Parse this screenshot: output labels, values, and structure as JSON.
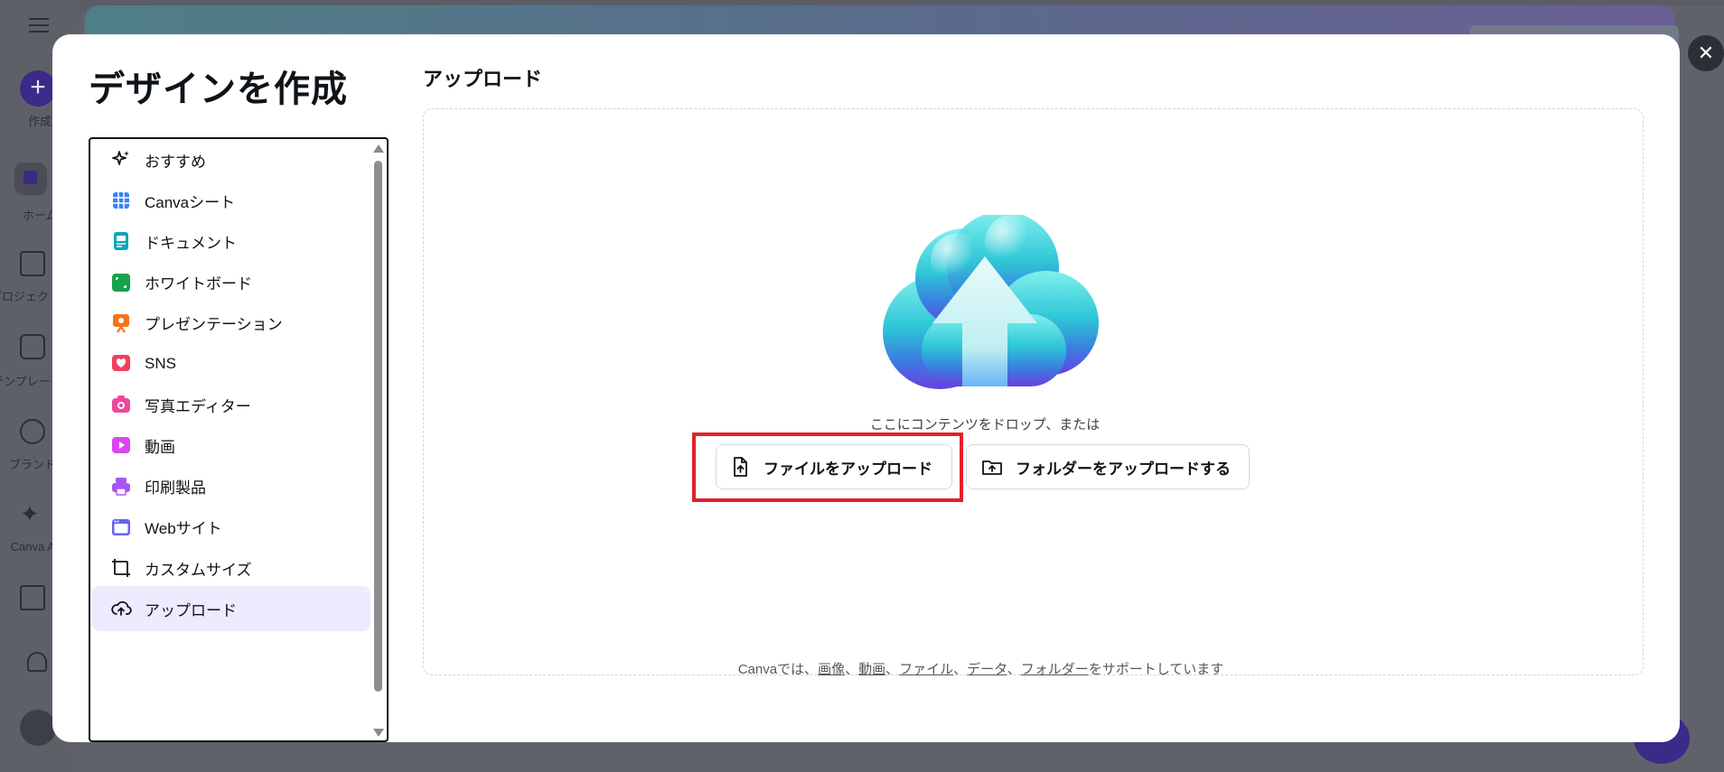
{
  "background": {
    "rail": {
      "create_label": "作成",
      "items": [
        {
          "label": "ホーム"
        },
        {
          "label": "プロジェクト"
        },
        {
          "label": "テンプレート"
        },
        {
          "label": "ブランド"
        },
        {
          "label": "Canva AI"
        }
      ]
    }
  },
  "modal": {
    "title": "デザインを作成",
    "close_symbol": "✕",
    "categories": [
      {
        "label": "おすすめ",
        "icon": "sparkle-icon",
        "color": "#0e1318"
      },
      {
        "label": "Canvaシート",
        "icon": "sheets-icon",
        "color": "#3b82f6"
      },
      {
        "label": "ドキュメント",
        "icon": "document-icon",
        "color": "#0ea5b7"
      },
      {
        "label": "ホワイトボード",
        "icon": "whiteboard-icon",
        "color": "#16a34a"
      },
      {
        "label": "プレゼンテーション",
        "icon": "presentation-icon",
        "color": "#f97316"
      },
      {
        "label": "SNS",
        "icon": "heart-icon",
        "color": "#f43f5e"
      },
      {
        "label": "写真エディター",
        "icon": "camera-icon",
        "color": "#ec4899"
      },
      {
        "label": "動画",
        "icon": "video-icon",
        "color": "#d946ef"
      },
      {
        "label": "印刷製品",
        "icon": "printer-icon",
        "color": "#a855f7"
      },
      {
        "label": "Webサイト",
        "icon": "website-icon",
        "color": "#6366f1"
      },
      {
        "label": "カスタムサイズ",
        "icon": "custom-size-icon",
        "color": "#0e1318"
      },
      {
        "label": "アップロード",
        "icon": "cloud-upload-icon",
        "color": "#0e1318",
        "active": true
      }
    ],
    "upload": {
      "section_title": "アップロード",
      "drop_text": "ここにコンテンツをドロップ、または",
      "file_button": "ファイルをアップロード",
      "folder_button": "フォルダーをアップロードする",
      "support": {
        "prefix": "Canvaでは、",
        "links": [
          "画像",
          "動画",
          "ファイル",
          "データ",
          "フォルダー"
        ],
        "separator": "、",
        "suffix": "をサポートしています"
      }
    },
    "highlight_color": "#e3202a"
  }
}
